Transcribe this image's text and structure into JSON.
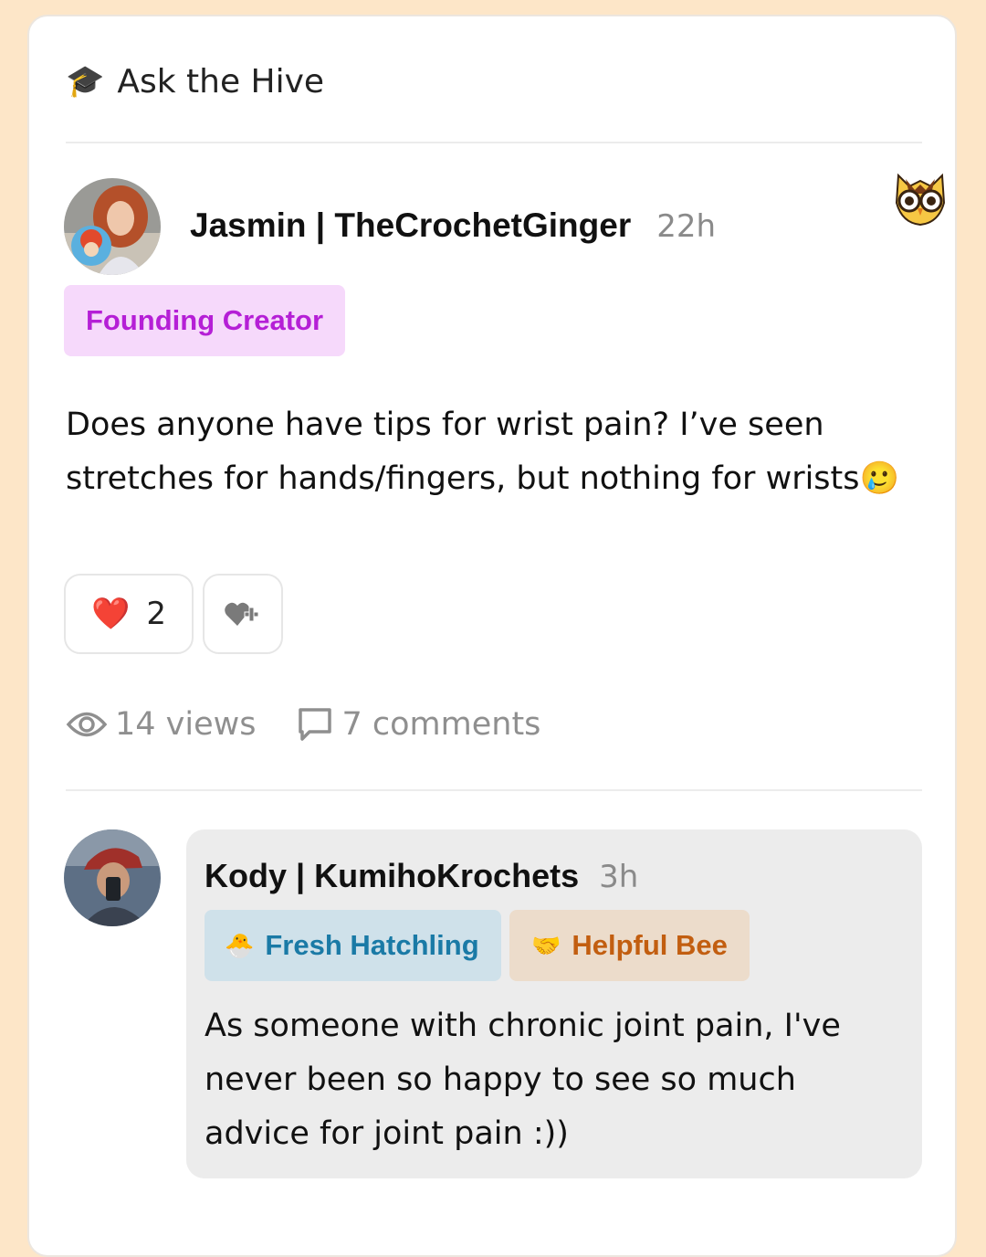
{
  "header": {
    "icon": "graduation-cap-icon",
    "title": "Ask the Hive"
  },
  "post": {
    "author": "Jasmin | TheCrochetGinger",
    "time": "22h",
    "badge": "Founding Creator",
    "body": "Does anyone have tips for wrist pain? I’ve seen stretches for hands/fingers, but nothing for wrists",
    "body_emoji": "🥲",
    "reaction": {
      "emoji": "❤️",
      "count": "2"
    },
    "add_reaction_icon": "heart-plus-icon",
    "views": "14 views",
    "comments": "7 comments"
  },
  "comment": {
    "author": "Kody | KumihoKrochets",
    "time": "3h",
    "badges": [
      {
        "emoji": "🐣",
        "label": "Fresh Hatchling"
      },
      {
        "emoji": "🤝",
        "label": "Helpful Bee"
      }
    ],
    "body": "As someone with chronic joint pain, I've never been so happy to see so much advice for joint pain :))"
  },
  "colors": {
    "page_bg": "#fde6c8",
    "founding_badge_bg": "#f6d9fb",
    "founding_badge_text": "#b51fd6",
    "fresh_badge_bg": "#cfe1ea",
    "fresh_badge_text": "#1a7aa6",
    "helpful_badge_bg": "#ecdccb",
    "helpful_badge_text": "#c25e10",
    "comment_bg": "#ececec"
  }
}
